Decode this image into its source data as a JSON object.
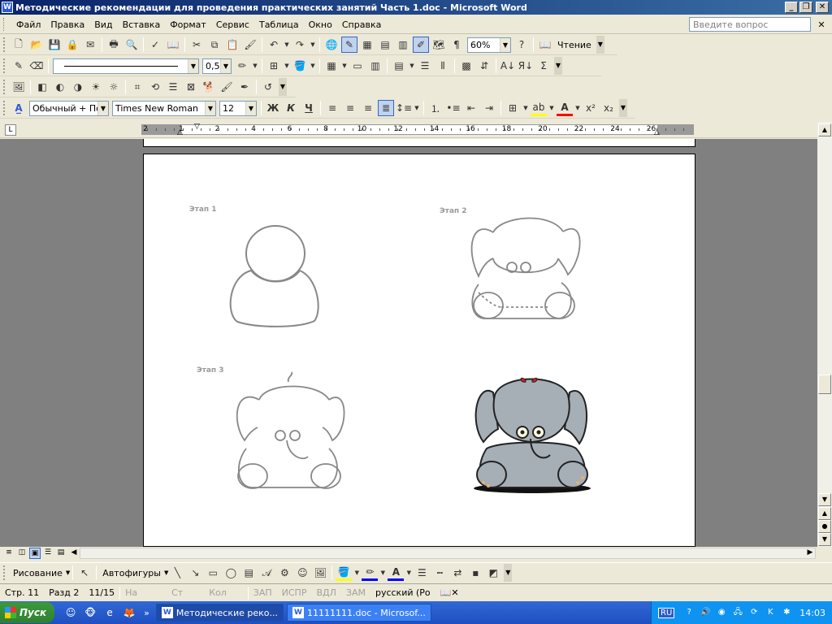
{
  "window": {
    "title": "Методические рекомендации для проведения практических занятий  Часть 1.doc - Microsoft Word"
  },
  "menu": {
    "items": [
      "Файл",
      "Правка",
      "Вид",
      "Вставка",
      "Формат",
      "Сервис",
      "Таблица",
      "Окно",
      "Справка"
    ],
    "help_placeholder": "Введите вопрос"
  },
  "toolbar_standard": {
    "zoom": "60%",
    "reading_label": "Чтение"
  },
  "toolbar_drawing_borders": {
    "line_weight": "0,5"
  },
  "toolbar_format": {
    "style": "Обычный + По ц",
    "font": "Times New Roman",
    "size": "12",
    "bold": "Ж",
    "italic": "К",
    "underline": "Ч"
  },
  "ruler": {
    "numbers": [
      "2",
      "1",
      "2",
      "4",
      "6",
      "8",
      "10",
      "12",
      "14",
      "16",
      "18",
      "20",
      "22",
      "24",
      "26"
    ]
  },
  "page": {
    "stages": [
      "Этап 1",
      "Этап 2",
      "Этап 3"
    ]
  },
  "drawing_toolbar": {
    "drawing_label": "Рисование",
    "autoshapes_label": "Автофигуры"
  },
  "status": {
    "page": "Стр.  11",
    "section": "Разд  2",
    "pages": "11/15",
    "at": "На",
    "line": "Ст",
    "col": "Кол",
    "rec": "ЗАП",
    "trk": "ИСПР",
    "ext": "ВДЛ",
    "ovr": "ЗАМ",
    "language": "русский (Ро"
  },
  "taskbar": {
    "start": "Пуск",
    "tasks": [
      "Методические реко...",
      "11111111.doc - Microsof..."
    ],
    "lang": "RU",
    "clock": "14:03"
  },
  "colors": {
    "title_gradient_start": "#0a246a",
    "title_gradient_end": "#3a6ea5",
    "taskbar": "#3168d5",
    "tray": "#0f93f1",
    "elephant_fill": "#a6aeb6",
    "bow": "#d22020"
  }
}
